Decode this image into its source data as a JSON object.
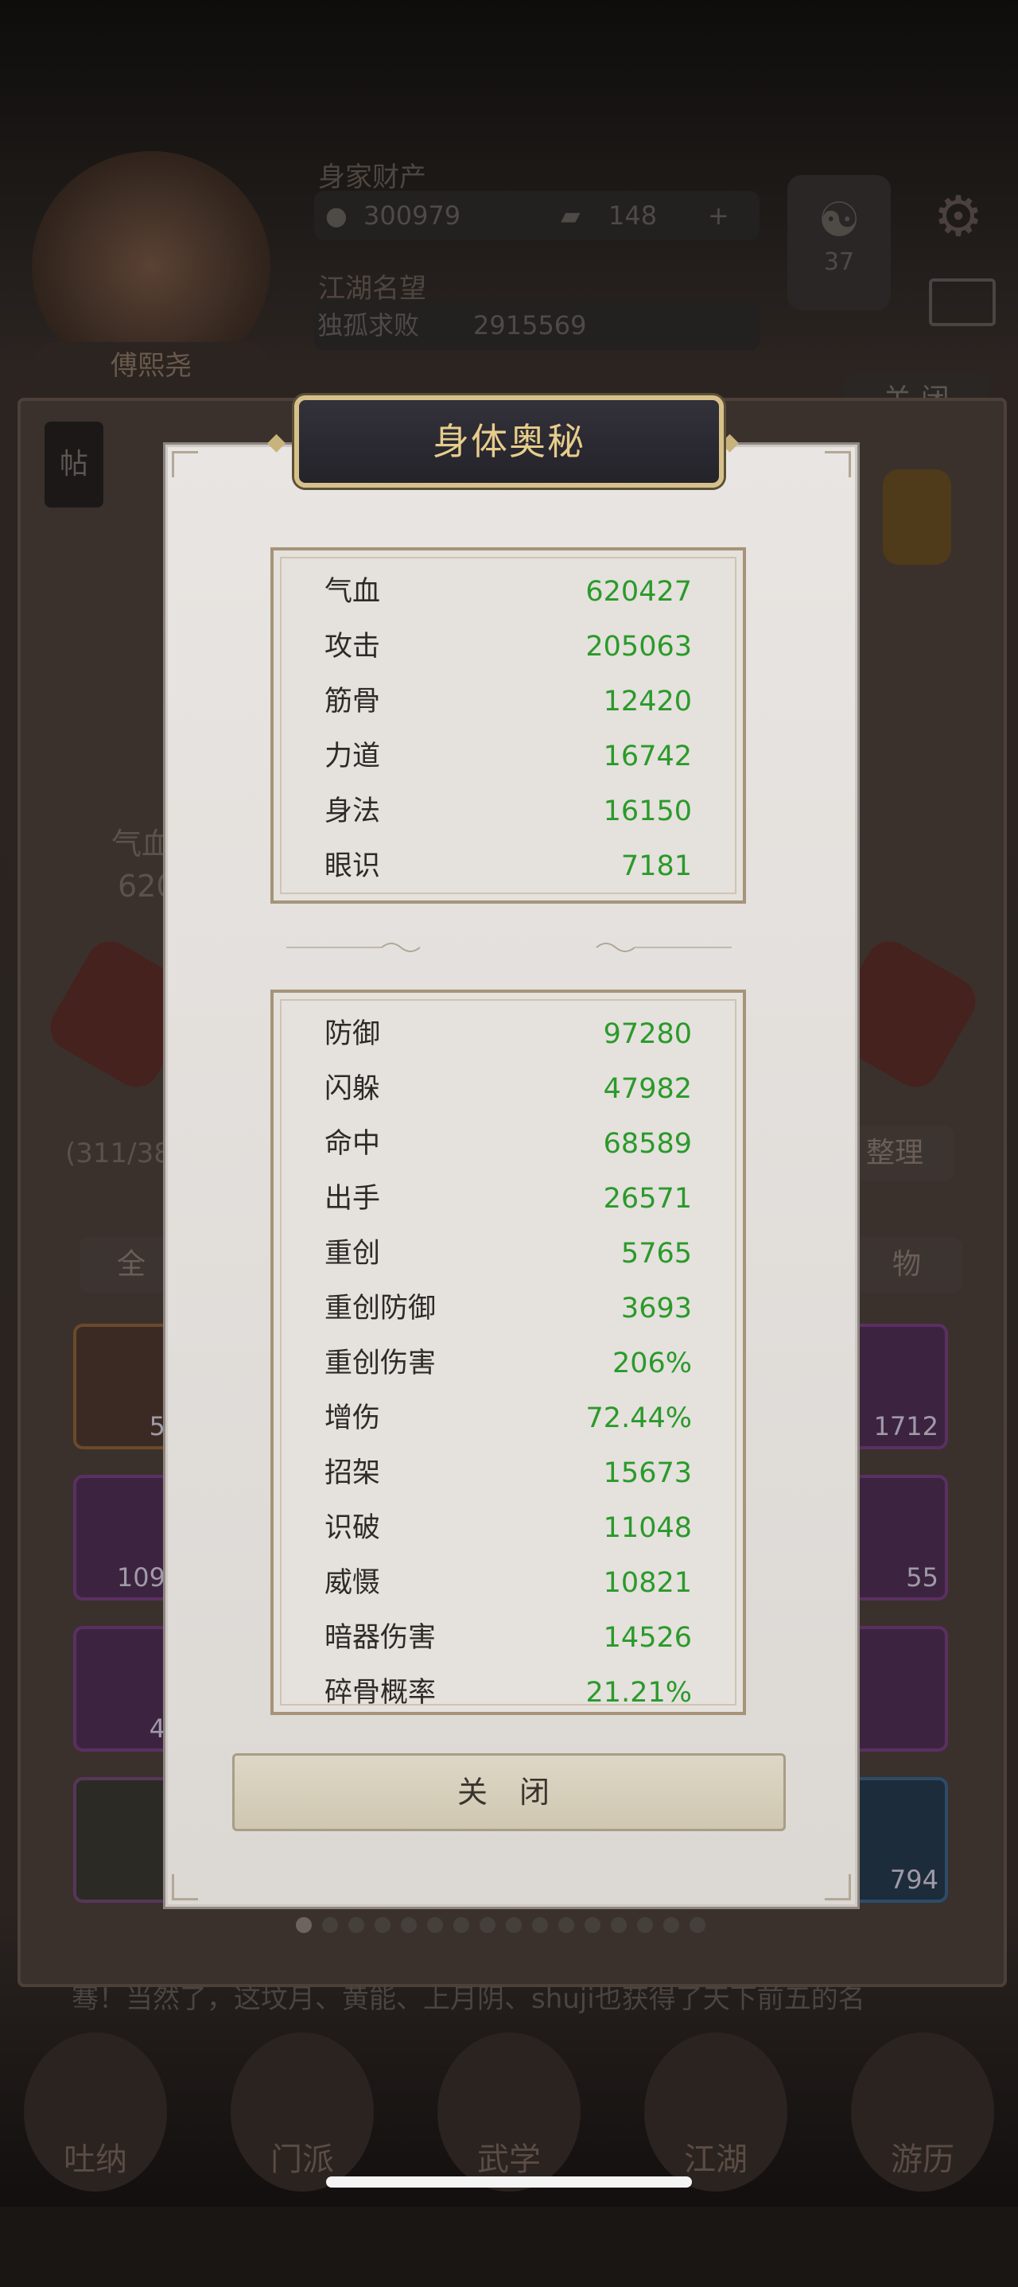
{
  "dialog": {
    "title": "身体奥秘",
    "close_label": "关 闭",
    "primary_stats": [
      {
        "label": "气血",
        "value": "620427"
      },
      {
        "label": "攻击",
        "value": "205063"
      },
      {
        "label": "筋骨",
        "value": "12420"
      },
      {
        "label": "力道",
        "value": "16742"
      },
      {
        "label": "身法",
        "value": "16150"
      },
      {
        "label": "眼识",
        "value": "7181"
      }
    ],
    "secondary_stats": [
      {
        "label": "防御",
        "value": "97280"
      },
      {
        "label": "闪躲",
        "value": "47982"
      },
      {
        "label": "命中",
        "value": "68589"
      },
      {
        "label": "出手",
        "value": "26571"
      },
      {
        "label": "重创",
        "value": "5765"
      },
      {
        "label": "重创防御",
        "value": "3693"
      },
      {
        "label": "重创伤害",
        "value": "206%"
      },
      {
        "label": "增伤",
        "value": "72.44%"
      },
      {
        "label": "招架",
        "value": "15673"
      },
      {
        "label": "识破",
        "value": "11048"
      },
      {
        "label": "威慑",
        "value": "10821"
      },
      {
        "label": "暗器伤害",
        "value": "14526"
      },
      {
        "label": "碎骨概率",
        "value": "21.21%"
      }
    ],
    "value_color": "#2a9a2a"
  },
  "background": {
    "player_name": "傅熙尧",
    "wealth_label": "身家财产",
    "gold": "300979",
    "tickets": "148",
    "plus": "+",
    "fame_label": "江湖名望",
    "fame_title": "独孤求败",
    "fame_value": "2915569",
    "level": "37",
    "close_tab": "关 闭",
    "post": "帖",
    "hp_label": "气血",
    "hp_value": "620",
    "bag_count": "(311/38",
    "sort": "整理",
    "filter_all": "全",
    "filter_item": "物",
    "slots": [
      "5",
      "1712",
      "109",
      "55",
      "4",
      "794"
    ],
    "ticker": "骞！当然了，这坟月、黄能、上月阴、shuji也获得了天下前五的名",
    "nav": [
      "吐纳",
      "门派",
      "武学",
      "江湖",
      "游历"
    ]
  },
  "pager": {
    "count": 16,
    "active_index": 0
  },
  "icons": [
    "gold-coin-icon",
    "ticket-icon",
    "gear-icon",
    "mail-icon",
    "yin-yang-icon",
    "ornament-icon"
  ]
}
